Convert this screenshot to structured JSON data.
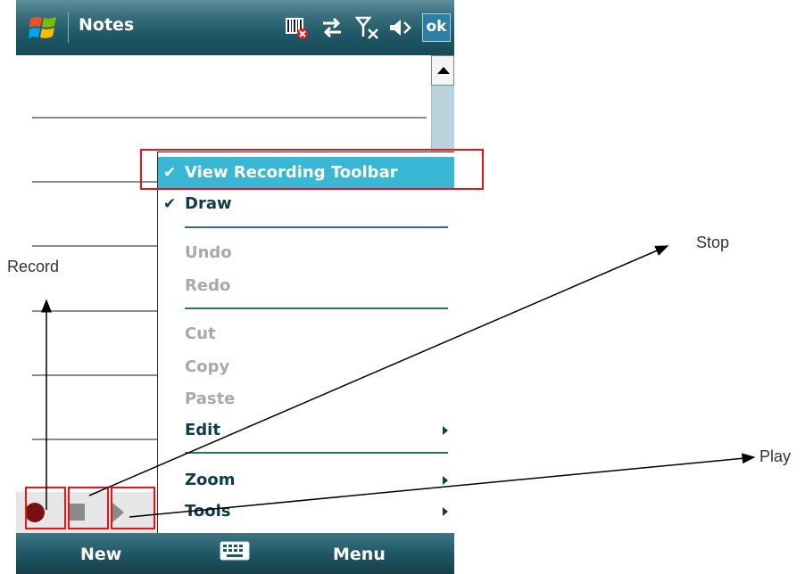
{
  "titlebar": {
    "app_title": "Notes",
    "ok_label": "ok",
    "icons": [
      "windows-logo",
      "barcode-icon",
      "sync-icon",
      "signal-off-icon",
      "speaker-icon"
    ]
  },
  "menu": {
    "items": [
      {
        "label": "View Recording Toolbar",
        "checked": true,
        "enabled": true,
        "submenu": false,
        "highlighted": true
      },
      {
        "label": "Draw",
        "checked": true,
        "enabled": true,
        "submenu": false
      },
      {
        "label": "Undo",
        "checked": false,
        "enabled": false,
        "submenu": false
      },
      {
        "label": "Redo",
        "checked": false,
        "enabled": false,
        "submenu": false
      },
      {
        "label": "Cut",
        "checked": false,
        "enabled": false,
        "submenu": false
      },
      {
        "label": "Copy",
        "checked": false,
        "enabled": false,
        "submenu": false
      },
      {
        "label": "Paste",
        "checked": false,
        "enabled": false,
        "submenu": false
      },
      {
        "label": "Edit",
        "checked": false,
        "enabled": true,
        "submenu": true
      },
      {
        "label": "Zoom",
        "checked": false,
        "enabled": true,
        "submenu": true
      },
      {
        "label": "Tools",
        "checked": false,
        "enabled": true,
        "submenu": true
      }
    ],
    "check_glyph": "✔"
  },
  "softkeys": {
    "left": "New",
    "right": "Menu"
  },
  "recording_toolbar": {
    "buttons": [
      "record",
      "stop",
      "play"
    ]
  },
  "annotations": {
    "record": "Record",
    "stop": "Stop",
    "play": "Play"
  },
  "colors": {
    "titlebar": "#1f5866",
    "highlight": "#3ab7d4",
    "menu_text": "#0c3d48",
    "disabled_text": "#a9a9a9",
    "callout_red": "#e8141c"
  }
}
